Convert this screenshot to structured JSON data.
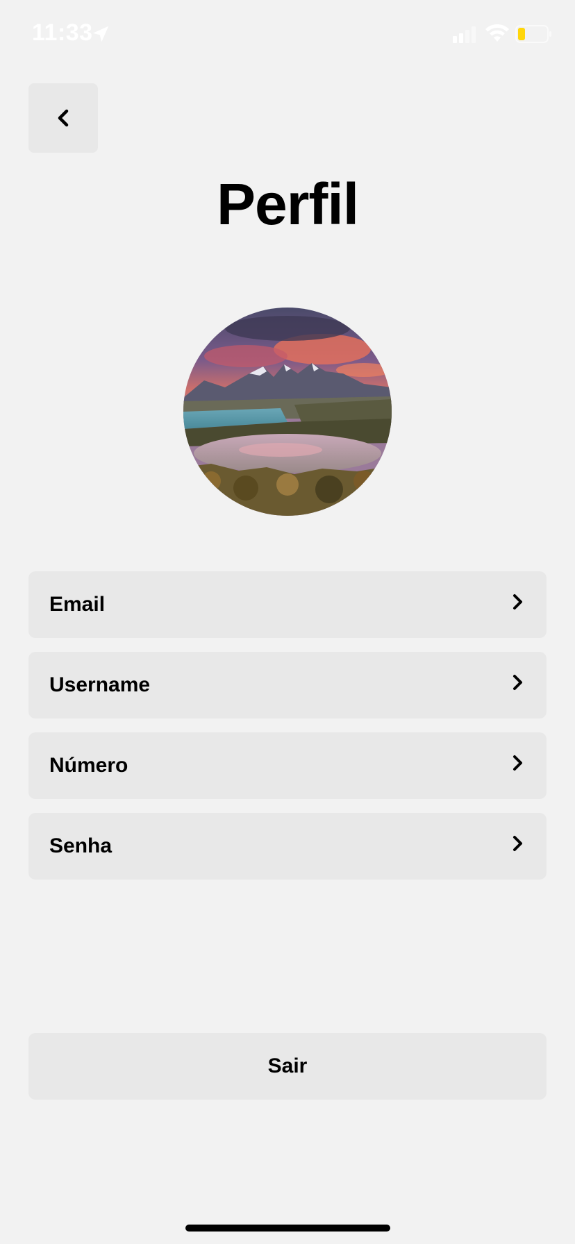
{
  "status_bar": {
    "time": "11:33",
    "icons": [
      "location-arrow-icon",
      "cellular-signal-icon",
      "wifi-icon",
      "battery-icon"
    ]
  },
  "header": {
    "back_icon": "chevron-left-icon",
    "title": "Perfil"
  },
  "avatar": {
    "description_icon": "landscape-photo"
  },
  "menu": {
    "items": [
      {
        "label": "Email",
        "icon": "chevron-right-icon"
      },
      {
        "label": "Username",
        "icon": "chevron-right-icon"
      },
      {
        "label": "Número",
        "icon": "chevron-right-icon"
      },
      {
        "label": "Senha",
        "icon": "chevron-right-icon"
      }
    ]
  },
  "logout": {
    "label": "Sair"
  },
  "colors": {
    "background": "#f2f2f2",
    "card": "#e8e8e8",
    "text": "#000000",
    "battery": "#ffd60a"
  }
}
